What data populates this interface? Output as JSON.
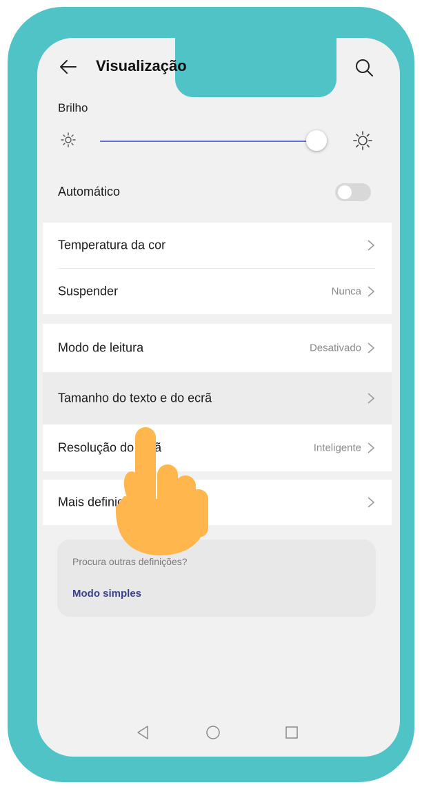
{
  "header": {
    "title": "Visualização",
    "back_icon": "arrow-left-icon",
    "search_icon": "search-icon"
  },
  "brightness": {
    "label": "Brilho",
    "level": 0.95,
    "min_icon": "sun-small-icon",
    "max_icon": "sun-large-icon"
  },
  "automatic": {
    "label": "Automático",
    "enabled": false
  },
  "settings": {
    "temperature": {
      "label": "Temperatura da cor"
    },
    "suspend": {
      "label": "Suspender",
      "value": "Nunca"
    },
    "reading_mode": {
      "label": "Modo de leitura",
      "value": "Desativado"
    },
    "text_size": {
      "label": "Tamanho do texto e do ecrã"
    },
    "resolution": {
      "label": "Resolução do ecrã",
      "value": "Inteligente"
    },
    "more": {
      "label": "Mais definições de ecrã"
    }
  },
  "card": {
    "question": "Procura outras definições?",
    "link": "Modo simples"
  },
  "nav": {
    "back_icon": "triangle-back-icon",
    "home_icon": "circle-home-icon",
    "recent_icon": "square-recent-icon"
  },
  "colors": {
    "frame": "#4fc3c6",
    "accent": "#5b6fd6",
    "hand": "#ffb74d"
  }
}
